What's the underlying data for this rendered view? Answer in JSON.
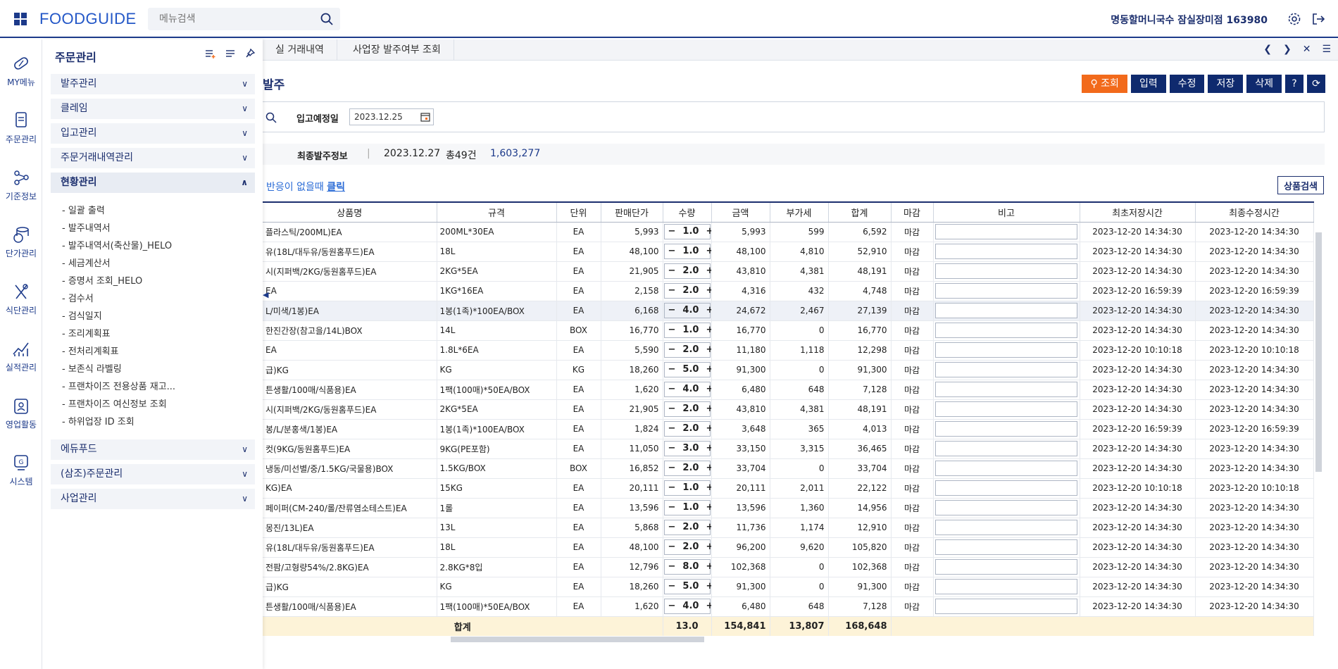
{
  "header": {
    "logo": "FOODGUIDE",
    "search_placeholder": "메뉴검색",
    "user": "명동할머니국수 잠실장미점 163980"
  },
  "rail": [
    {
      "label": "MY메뉴",
      "icon": "pill-icon"
    },
    {
      "label": "주문관리",
      "icon": "document-icon"
    },
    {
      "label": "기준정보",
      "icon": "share-nodes-icon"
    },
    {
      "label": "단가관리",
      "icon": "coins-icon"
    },
    {
      "label": "식단관리",
      "icon": "utensils-icon"
    },
    {
      "label": "실적관리",
      "icon": "chart-line-icon"
    },
    {
      "label": "영업활동",
      "icon": "badge-icon"
    },
    {
      "label": "시스템",
      "icon": "system-icon"
    }
  ],
  "sidemenu": {
    "title": "주문관리",
    "groups_top": [
      "발주관리",
      "클레임",
      "입고관리",
      "주문거래내역관리"
    ],
    "open_group": "현황관리",
    "sub_items": [
      "일괄 출력",
      "발주내역서",
      "발주내역서(축산물)_HELO",
      "세금계산서",
      "증명서 조회_HELO",
      "검수서",
      "검식일지",
      "조리계획표",
      "전처리계획표",
      "보존식 라벨링",
      "프랜차이즈 전용상품 재고...",
      "프랜차이즈 여신정보 조회",
      "하위업장 ID 조회"
    ],
    "groups_bottom": [
      "에듀푸드",
      "(삼조)주문관리",
      "사업관리"
    ]
  },
  "tabs": [
    "실 거래내역",
    "사업장 발주여부 조회"
  ],
  "page": {
    "title": "발주",
    "actions": {
      "search": "조회",
      "input": "입력",
      "edit": "수정",
      "save": "저장",
      "delete": "삭제",
      "help": "?"
    },
    "filter_label": "입고예정일",
    "filter_date": "2023.12.25",
    "summary": {
      "label": "최종발주정보",
      "date": "2023.12.27",
      "count": "총49건",
      "amount": "1,603,277"
    },
    "notice_prefix": "반응이 없을때",
    "notice_link": "클릭",
    "product_search": "상품검색"
  },
  "grid": {
    "columns": [
      "상품명",
      "규격",
      "단위",
      "판매단가",
      "수량",
      "금액",
      "부가세",
      "합계",
      "마감",
      "비고",
      "최초저장시간",
      "최종수정시간"
    ],
    "rows": [
      [
        "플라스틱/200ML)EA",
        "200ML*30EA",
        "EA",
        "5,993",
        "1.0",
        "5,993",
        "599",
        "6,592",
        "마감",
        "2023-12-20 14:34:30",
        "2023-12-20 14:34:30"
      ],
      [
        "유(18L/대두유/동원홈푸드)EA",
        "18L",
        "EA",
        "48,100",
        "1.0",
        "48,100",
        "4,810",
        "52,910",
        "마감",
        "2023-12-20 14:34:30",
        "2023-12-20 14:34:30"
      ],
      [
        "시(지퍼백/2KG/동원홈푸드)EA",
        "2KG*5EA",
        "EA",
        "21,905",
        "2.0",
        "43,810",
        "4,381",
        "48,191",
        "마감",
        "2023-12-20 14:34:30",
        "2023-12-20 14:34:30"
      ],
      [
        "EA",
        "1KG*16EA",
        "EA",
        "2,158",
        "2.0",
        "4,316",
        "432",
        "4,748",
        "마감",
        "2023-12-20 16:59:39",
        "2023-12-20 16:59:39"
      ],
      [
        "L/미색/1봉)EA",
        "1봉(1족)*100EA/BOX",
        "EA",
        "6,168",
        "4.0",
        "24,672",
        "2,467",
        "27,139",
        "마감",
        "2023-12-20 14:34:30",
        "2023-12-20 14:34:30"
      ],
      [
        "한진간장(참고을/14L)BOX",
        "14L",
        "BOX",
        "16,770",
        "1.0",
        "16,770",
        "0",
        "16,770",
        "마감",
        "2023-12-20 14:34:30",
        "2023-12-20 14:34:30"
      ],
      [
        "EA",
        "1.8L*6EA",
        "EA",
        "5,590",
        "2.0",
        "11,180",
        "1,118",
        "12,298",
        "마감",
        "2023-12-20 10:10:18",
        "2023-12-20 10:10:18"
      ],
      [
        "급)KG",
        "KG",
        "KG",
        "18,260",
        "5.0",
        "91,300",
        "0",
        "91,300",
        "마감",
        "2023-12-20 14:34:30",
        "2023-12-20 14:34:30"
      ],
      [
        "튼생활/100매/식품용)EA",
        "1팩(100매)*50EA/BOX",
        "EA",
        "1,620",
        "4.0",
        "6,480",
        "648",
        "7,128",
        "마감",
        "2023-12-20 14:34:30",
        "2023-12-20 14:34:30"
      ],
      [
        "시(지퍼백/2KG/동원홈푸드)EA",
        "2KG*5EA",
        "EA",
        "21,905",
        "2.0",
        "43,810",
        "4,381",
        "48,191",
        "마감",
        "2023-12-20 14:34:30",
        "2023-12-20 14:34:30"
      ],
      [
        "봉/L/분홍색/1봉)EA",
        "1봉(1족)*100EA/BOX",
        "EA",
        "1,824",
        "2.0",
        "3,648",
        "365",
        "4,013",
        "마감",
        "2023-12-20 16:59:39",
        "2023-12-20 16:59:39"
      ],
      [
        "컷(9KG/동원홈푸드)EA",
        "9KG(PE포함)",
        "EA",
        "11,050",
        "3.0",
        "33,150",
        "3,315",
        "36,465",
        "마감",
        "2023-12-20 14:34:30",
        "2023-12-20 14:34:30"
      ],
      [
        "냉동/미선별/중/1.5KG/국물용)BOX",
        "1.5KG/BOX",
        "BOX",
        "16,852",
        "2.0",
        "33,704",
        "0",
        "33,704",
        "마감",
        "2023-12-20 14:34:30",
        "2023-12-20 14:34:30"
      ],
      [
        "KG)EA",
        "15KG",
        "EA",
        "20,111",
        "1.0",
        "20,111",
        "2,011",
        "22,122",
        "마감",
        "2023-12-20 10:10:18",
        "2023-12-20 10:10:18"
      ],
      [
        "페이퍼(CM-240/롤/잔류염소테스트)EA",
        "1롤",
        "EA",
        "13,596",
        "1.0",
        "13,596",
        "1,360",
        "14,956",
        "마감",
        "2023-12-20 14:34:30",
        "2023-12-20 14:34:30"
      ],
      [
        "몽진/13L)EA",
        "13L",
        "EA",
        "5,868",
        "2.0",
        "11,736",
        "1,174",
        "12,910",
        "마감",
        "2023-12-20 14:34:30",
        "2023-12-20 14:34:30"
      ],
      [
        "유(18L/대두유/동원홈푸드)EA",
        "18L",
        "EA",
        "48,100",
        "2.0",
        "96,200",
        "9,620",
        "105,820",
        "마감",
        "2023-12-20 14:34:30",
        "2023-12-20 14:34:30"
      ],
      [
        "전팜/고형량54%/2.8KG)EA",
        "2.8KG*8입",
        "EA",
        "12,796",
        "8.0",
        "102,368",
        "0",
        "102,368",
        "마감",
        "2023-12-20 14:34:30",
        "2023-12-20 14:34:30"
      ],
      [
        "급)KG",
        "KG",
        "EA",
        "18,260",
        "5.0",
        "91,300",
        "0",
        "91,300",
        "마감",
        "2023-12-20 14:34:30",
        "2023-12-20 14:34:30"
      ],
      [
        "튼생활/100매/식품용)EA",
        "1팩(100매)*50EA/BOX",
        "EA",
        "1,620",
        "4.0",
        "6,480",
        "648",
        "7,128",
        "마감",
        "2023-12-20 14:34:30",
        "2023-12-20 14:34:30"
      ]
    ],
    "total": {
      "label": "합계",
      "qty": "13.0",
      "amount": "154,841",
      "vat": "13,807",
      "sum": "168,648"
    }
  }
}
